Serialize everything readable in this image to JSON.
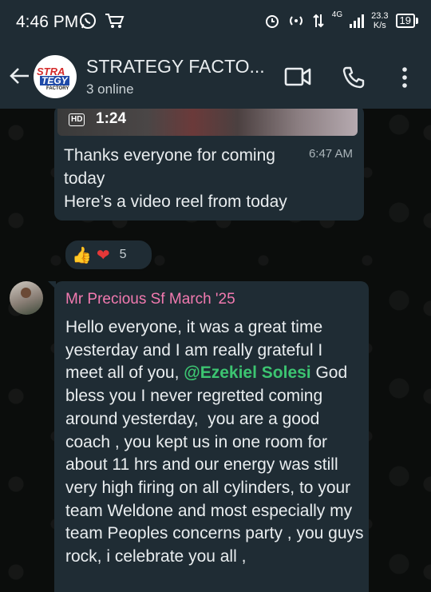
{
  "status_bar": {
    "time": "4:46 PM",
    "network_type": "4G",
    "speed_value": "23.3",
    "speed_unit": "K/s",
    "battery": "19"
  },
  "header": {
    "title": "STRATEGY FACTO...",
    "subtitle": "3 online",
    "avatar_text": {
      "line1": "STRA",
      "line2": "TEGY",
      "line3": "FACTORY"
    }
  },
  "messages": [
    {
      "video_quality": "HD",
      "video_duration": "1:24",
      "text": "Thanks everyone for coming today\nHere’s a video reel from today",
      "time": "6:47 AM",
      "reactions": {
        "emojis": [
          "👍",
          "❤"
        ],
        "count": "5"
      }
    },
    {
      "sender": "Mr Precious Sf March '25",
      "text_before_mention": "Hello everyone, it was a great time yesterday and I am really grateful I meet all of you, ",
      "mention": "@Ezekiel Solesi",
      "text_after_mention": " God bless you I never regretted coming around yesterday,  you are a good coach , you kept us in one room for about 11 hrs and our energy was still very high firing on all cylinders, to your team Weldone and most especially my team Peoples concerns party , you guys rock, i celebrate you all ,"
    }
  ]
}
